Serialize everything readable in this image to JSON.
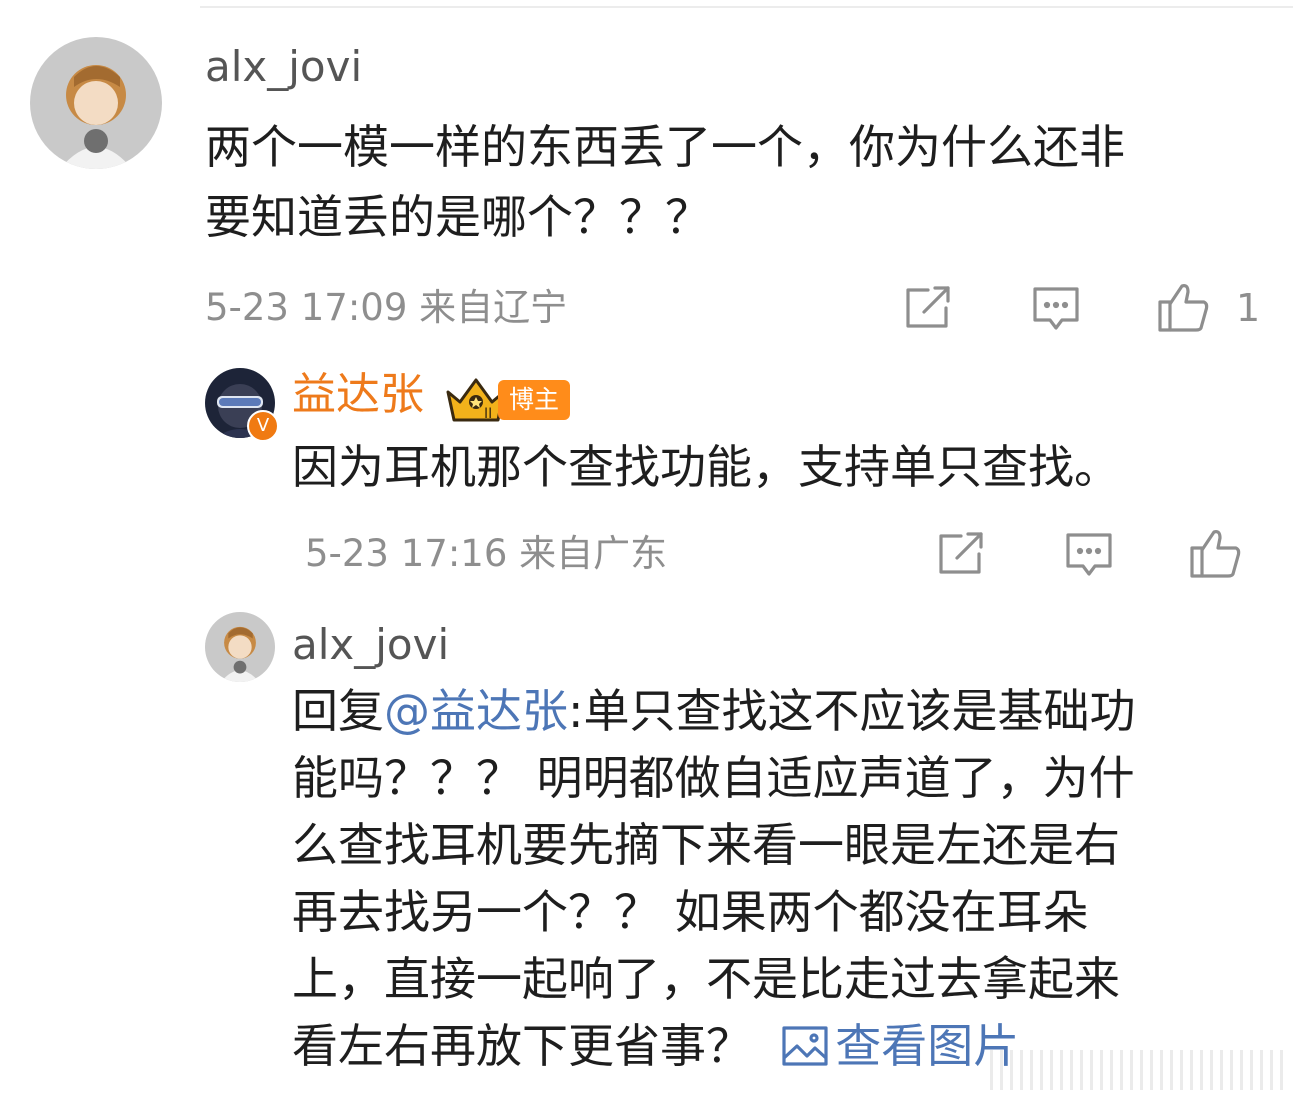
{
  "comment": {
    "username": "alx_jovi",
    "text_lines": [
      "两个一模一样的东西丢了一个，你为什么还非",
      "要知道丢的是哪个？？？"
    ],
    "timestamp": "5-23 17:09 来自辽宁",
    "like_count": "1"
  },
  "reply1": {
    "username": "益达张",
    "badge": "博主",
    "text": "因为耳机那个查找功能，支持单只查找。",
    "timestamp": "5-23 17:16 来自广东"
  },
  "reply2": {
    "username": "alx_jovi",
    "prefix": "回复",
    "mention": "@益达张",
    "line1_rest": ":单只查找这不应该是基础功",
    "lines": [
      "能吗？？？ 明明都做自适应声道了，为什",
      "么查找耳机要先摘下来看一眼是左还是右",
      "再去找另一个？？ 如果两个都没在耳朵",
      "上，直接一起响了，不是比走过去拿起来"
    ],
    "last_line": "看左右再放下更省事？",
    "view_image": "查看图片"
  },
  "colors": {
    "primary_text": "#1e1e1e",
    "secondary_text": "#8e8e8e",
    "blogger_name": "#ee7a1b",
    "link": "#4d76b6",
    "badge": "#ff8c1a"
  }
}
